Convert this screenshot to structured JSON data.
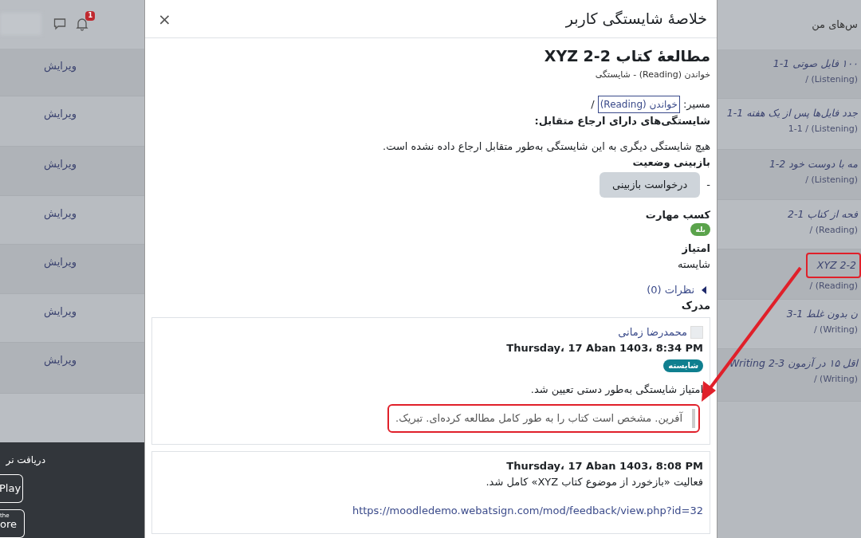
{
  "header": {
    "notification_count": "1"
  },
  "page_title": "س‌های من",
  "rows": [
    {
      "title": "۱۰۰ فایل صوتی 1-1",
      "path": "(Listening) /",
      "action": "ویرایش",
      "highlighted": false
    },
    {
      "title": "جدد فایل‌ها پس از یک هفته 1-1",
      "path": "(Listening) / 1-1",
      "action": "ویرایش",
      "highlighted": false
    },
    {
      "title": "مه با دوست خود 2-1",
      "path": "(Listening) /",
      "action": "ویرایش",
      "highlighted": false
    },
    {
      "title": "فحه از کتاب 1-2",
      "path": "(Reading) /",
      "action": "ویرایش",
      "highlighted": false
    },
    {
      "title": "2-2 XYZ",
      "path": "(Reading) /",
      "action": "ویرایش",
      "highlighted": true
    },
    {
      "title": "ن بدون غلط 1-3",
      "path": "(Writing) /",
      "action": "ویرایش",
      "highlighted": false
    },
    {
      "title": "اقل ۱۵ در آزمون 3-2 Writing",
      "path": "(Writing) /",
      "action": "ویرایش",
      "highlighted": false
    }
  ],
  "footer": {
    "heading": "دریافت نر",
    "play_button": "Play",
    "store_button": {
      "small": "the",
      "large": "ore"
    }
  },
  "modal": {
    "title": "خلاصهٔ شایستگی کاربر",
    "close": "×",
    "competency": {
      "name": "مطالعهٔ کتاب 2-2 XYZ",
      "subtitle": "خواندن (Reading) - شایستگی"
    },
    "path": {
      "label": "مسیر:",
      "link": "خواندن (Reading)",
      "separator": "/"
    },
    "cross_ref": {
      "label": "شایستگی‌های دارای ارجاع متقابل:",
      "text": "هیچ شایستگی دیگری به این شایستگی به‌طور متقابل ارجاع داده نشده است."
    },
    "review": {
      "label": "بازبینی وضعیت",
      "dash": "-",
      "button": "درخواست بازبینی"
    },
    "proficiency": {
      "label": "کسب مهارت",
      "badge": "بله"
    },
    "rating": {
      "label": "امتیاز",
      "value": "شایسته"
    },
    "comments": {
      "link": "نظرات (0)",
      "expanded": false
    },
    "evidence_label": "مدرک",
    "evidence": [
      {
        "kind": "rating",
        "author": "محمدرضا زمانی",
        "date": "Thursday، 17 Aban 1403، 8:34 PM",
        "badge": "شایسته",
        "text": "امتیاز شایستگی به‌طور دستی تعیین شد.",
        "note": "آفرین. مشخص است کتاب را به طور کامل مطالعه کرده‌ای. تبریک.",
        "highlighted": true
      },
      {
        "kind": "activity",
        "date": "Thursday، 17 Aban 1403، 8:08 PM",
        "text": "فعالیت «بازخورد از موضوع کتاب XYZ» کامل شد.",
        "url": "https://moodledemo.webatsign.com/mod/feedback/view.php?id=32"
      }
    ]
  }
}
